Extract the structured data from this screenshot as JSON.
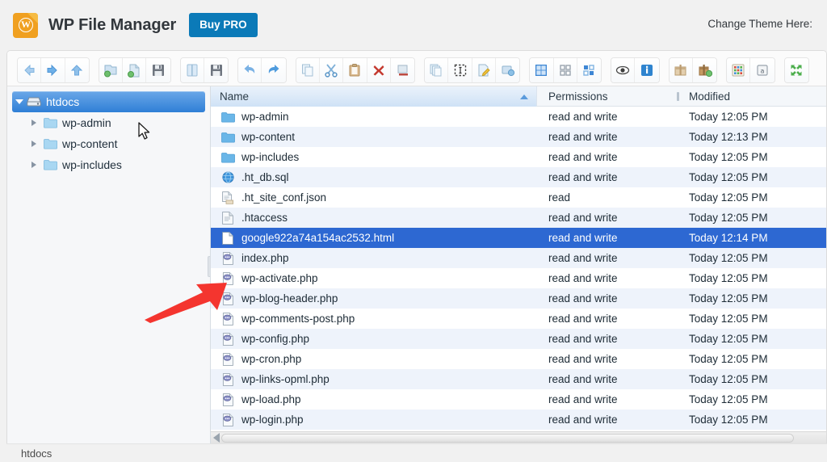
{
  "header": {
    "app_title": "WP File Manager",
    "logo_icon": "wordpress-folder-icon",
    "logo_glyph": "W",
    "buy_pro_label": "Buy PRO",
    "change_theme_label": "Change Theme Here:",
    "brand_orange": "#f0a020",
    "buy_pro_blue": "#0b7ab8"
  },
  "toolbar": {
    "groups": [
      {
        "name": "navigation",
        "buttons": [
          {
            "icon": "back-arrow-icon",
            "label": "Back"
          },
          {
            "icon": "forward-arrow-icon",
            "label": "Forward"
          },
          {
            "icon": "up-arrow-icon",
            "label": "Up"
          }
        ]
      },
      {
        "name": "create",
        "buttons": [
          {
            "icon": "new-folder-icon",
            "label": "New folder"
          },
          {
            "icon": "new-file-icon",
            "label": "New file"
          },
          {
            "icon": "save-icon",
            "label": "Save"
          }
        ]
      },
      {
        "name": "open-save",
        "buttons": [
          {
            "icon": "open-book-icon",
            "label": "Open"
          },
          {
            "icon": "floppy-disk-icon",
            "label": "Save as"
          }
        ]
      },
      {
        "name": "undo-redo",
        "buttons": [
          {
            "icon": "undo-icon",
            "label": "Undo"
          },
          {
            "icon": "redo-icon",
            "label": "Redo"
          }
        ]
      },
      {
        "name": "clipboard",
        "buttons": [
          {
            "icon": "copy-icon",
            "label": "Copy"
          },
          {
            "icon": "cut-scissors-icon",
            "label": "Cut"
          },
          {
            "icon": "paste-icon",
            "label": "Paste"
          },
          {
            "icon": "delete-x-icon",
            "label": "Delete"
          },
          {
            "icon": "empty-folder-icon",
            "label": "Empty"
          }
        ]
      },
      {
        "name": "edit",
        "buttons": [
          {
            "icon": "duplicate-icon",
            "label": "Duplicate"
          },
          {
            "icon": "rename-select-icon",
            "label": "Rename"
          },
          {
            "icon": "edit-file-icon",
            "label": "Edit"
          },
          {
            "icon": "resize-image-icon",
            "label": "Resize & Rotate"
          }
        ]
      },
      {
        "name": "view-mode",
        "buttons": [
          {
            "icon": "icons-view-icon",
            "label": "Icons view"
          },
          {
            "icon": "small-grid-icon",
            "label": "Small icons"
          },
          {
            "icon": "list-view-icon",
            "label": "List view"
          }
        ]
      },
      {
        "name": "info",
        "buttons": [
          {
            "icon": "preview-eye-icon",
            "label": "Preview"
          },
          {
            "icon": "info-icon",
            "label": "Get info"
          }
        ]
      },
      {
        "name": "archive",
        "buttons": [
          {
            "icon": "extract-archive-icon",
            "label": "Extract archive"
          },
          {
            "icon": "create-archive-icon",
            "label": "Create archive"
          }
        ]
      },
      {
        "name": "tools",
        "buttons": [
          {
            "icon": "chmod-grid-icon",
            "label": "Change permissions"
          },
          {
            "icon": "help-book-icon",
            "label": "Help"
          }
        ]
      },
      {
        "name": "fullscreen",
        "buttons": [
          {
            "icon": "fullscreen-icon",
            "label": "Full screen"
          }
        ]
      }
    ]
  },
  "sidebar": {
    "tree": [
      {
        "label": "htdocs",
        "icon": "drive-icon",
        "level": 0,
        "expanded": true,
        "selected": true
      },
      {
        "label": "wp-admin",
        "icon": "folder-icon",
        "level": 1,
        "expanded": false,
        "selected": false
      },
      {
        "label": "wp-content",
        "icon": "folder-icon",
        "level": 1,
        "expanded": false,
        "selected": false
      },
      {
        "label": "wp-includes",
        "icon": "folder-icon",
        "level": 1,
        "expanded": false,
        "selected": false
      }
    ]
  },
  "file_list": {
    "columns": {
      "name": "Name",
      "permissions": "Permissions",
      "modified": "Modified"
    },
    "sort": {
      "column": "Name",
      "direction": "asc",
      "icon": "sort-asc-icon"
    },
    "rows": [
      {
        "name": "wp-admin",
        "icon": "folder-icon",
        "permissions": "read and write",
        "modified": "Today 12:05 PM",
        "selected": false
      },
      {
        "name": "wp-content",
        "icon": "folder-icon",
        "permissions": "read and write",
        "modified": "Today 12:13 PM",
        "selected": false
      },
      {
        "name": "wp-includes",
        "icon": "folder-icon",
        "permissions": "read and write",
        "modified": "Today 12:05 PM",
        "selected": false
      },
      {
        "name": ".ht_db.sql",
        "icon": "sql-globe-icon",
        "permissions": "read and write",
        "modified": "Today 12:05 PM",
        "selected": false
      },
      {
        "name": ".ht_site_conf.json",
        "icon": "json-file-icon",
        "permissions": "read",
        "modified": "Today 12:05 PM",
        "selected": false
      },
      {
        "name": ".htaccess",
        "icon": "text-file-icon",
        "permissions": "read and write",
        "modified": "Today 12:05 PM",
        "selected": false
      },
      {
        "name": "google922a74a154ac2532.html",
        "icon": "html-file-icon",
        "permissions": "read and write",
        "modified": "Today 12:14 PM",
        "selected": true
      },
      {
        "name": "index.php",
        "icon": "php-file-icon",
        "permissions": "read and write",
        "modified": "Today 12:05 PM",
        "selected": false
      },
      {
        "name": "wp-activate.php",
        "icon": "php-file-icon",
        "permissions": "read and write",
        "modified": "Today 12:05 PM",
        "selected": false
      },
      {
        "name": "wp-blog-header.php",
        "icon": "php-file-icon",
        "permissions": "read and write",
        "modified": "Today 12:05 PM",
        "selected": false
      },
      {
        "name": "wp-comments-post.php",
        "icon": "php-file-icon",
        "permissions": "read and write",
        "modified": "Today 12:05 PM",
        "selected": false
      },
      {
        "name": "wp-config.php",
        "icon": "php-file-icon",
        "permissions": "read and write",
        "modified": "Today 12:05 PM",
        "selected": false
      },
      {
        "name": "wp-cron.php",
        "icon": "php-file-icon",
        "permissions": "read and write",
        "modified": "Today 12:05 PM",
        "selected": false
      },
      {
        "name": "wp-links-opml.php",
        "icon": "php-file-icon",
        "permissions": "read and write",
        "modified": "Today 12:05 PM",
        "selected": false
      },
      {
        "name": "wp-load.php",
        "icon": "php-file-icon",
        "permissions": "read and write",
        "modified": "Today 12:05 PM",
        "selected": false
      },
      {
        "name": "wp-login.php",
        "icon": "php-file-icon",
        "permissions": "read and write",
        "modified": "Today 12:05 PM",
        "selected": false
      }
    ],
    "selection_color": "#2d68d2"
  },
  "status_bar": {
    "path": "htdocs"
  },
  "annotations": {
    "arrow_color": "#f4352f",
    "arrow_target": "google922a74a154ac2532.html",
    "cursor_icon": "mouse-pointer-icon"
  }
}
